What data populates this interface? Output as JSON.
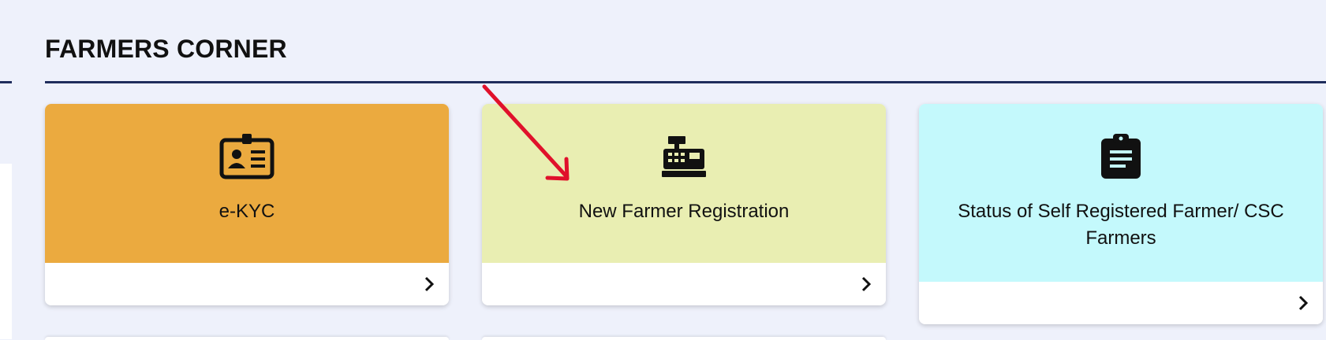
{
  "section": {
    "title": "FARMERS CORNER"
  },
  "cards": [
    {
      "label": "e-KYC",
      "icon": "id-card-icon",
      "bg": "#ebaa3f"
    },
    {
      "label": "New Farmer Registration",
      "icon": "cash-register-icon",
      "bg": "#e9eeb2"
    },
    {
      "label": "Status of Self Registered Farmer/ CSC Farmers",
      "icon": "clipboard-list-icon",
      "bg": "#c4f9fc"
    }
  ],
  "colors": {
    "page_bg": "#eef1fb",
    "rule": "#1f2d5c",
    "annotation_arrow": "#e0112b"
  }
}
